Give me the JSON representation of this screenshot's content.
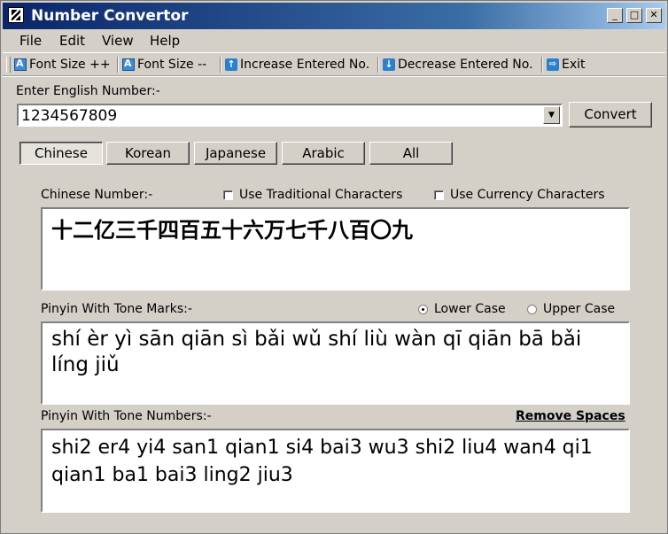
{
  "window": {
    "title": "Number Convertor",
    "controls": {
      "minimize": "_",
      "maximize": "□",
      "close": "✕"
    }
  },
  "menu": [
    "File",
    "Edit",
    "View",
    "Help"
  ],
  "toolbar": {
    "font_inc": "Font Size ++",
    "font_dec": "Font Size --",
    "increase": "Increase Entered No.",
    "decrease": "Decrease Entered No.",
    "exit": "Exit"
  },
  "input": {
    "label": "Enter English Number:-",
    "value": "1234567809",
    "convert_label": "Convert"
  },
  "tabs": [
    "Chinese",
    "Korean",
    "Japanese",
    "Arabic",
    "All"
  ],
  "chinese": {
    "label": "Chinese Number:-",
    "traditional_label": "Use Traditional Characters",
    "currency_label": "Use Currency Characters",
    "value": "十二亿三千四百五十六万七千八百〇九"
  },
  "pinyin_marks": {
    "label": "Pinyin With Tone Marks:-",
    "lower_label": "Lower Case",
    "upper_label": "Upper Case",
    "value": "shí èr yì sān qiān sì bǎi wǔ shí liù wàn qī qiān bā bǎi líng jiǔ"
  },
  "pinyin_numbers": {
    "label": "Pinyin With Tone Numbers:-",
    "remove_spaces": "Remove Spaces",
    "value": "shi2 er4 yi4 san1 qian1 si4 bai3 wu3 shi2 liu4 wan4 qi1 qian1 ba1 bai3 ling2 jiu3"
  }
}
